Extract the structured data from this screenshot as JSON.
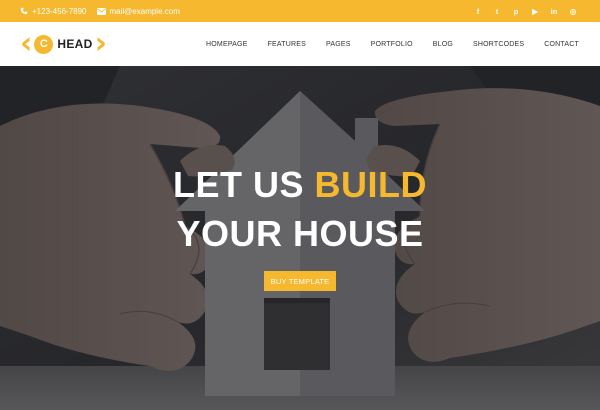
{
  "topbar": {
    "phone": "+123-456-7890",
    "email": "mail@example.com",
    "social": [
      {
        "icon": "facebook-icon",
        "glyph": "f"
      },
      {
        "icon": "twitter-icon",
        "glyph": "t"
      },
      {
        "icon": "pinterest-icon",
        "glyph": "p"
      },
      {
        "icon": "youtube-icon",
        "glyph": "▶"
      },
      {
        "icon": "linkedin-icon",
        "glyph": "in"
      },
      {
        "icon": "dribbble-icon",
        "glyph": "◎"
      }
    ]
  },
  "logo": {
    "badge": "C",
    "text": "HEAD"
  },
  "nav": {
    "items": [
      "HOMEPAGE",
      "FEATURES",
      "PAGES",
      "PORTFOLIO",
      "BLOG",
      "SHORTCODES",
      "CONTACT"
    ]
  },
  "hero": {
    "line1_part1": "LET US",
    "line1_accent": "BUILD",
    "line2": "YOUR HOUSE",
    "cta": "BUY TEMPLATE"
  },
  "colors": {
    "accent": "#f5b82e",
    "overlay": "#2a2b2e",
    "text": "#ffffff"
  }
}
